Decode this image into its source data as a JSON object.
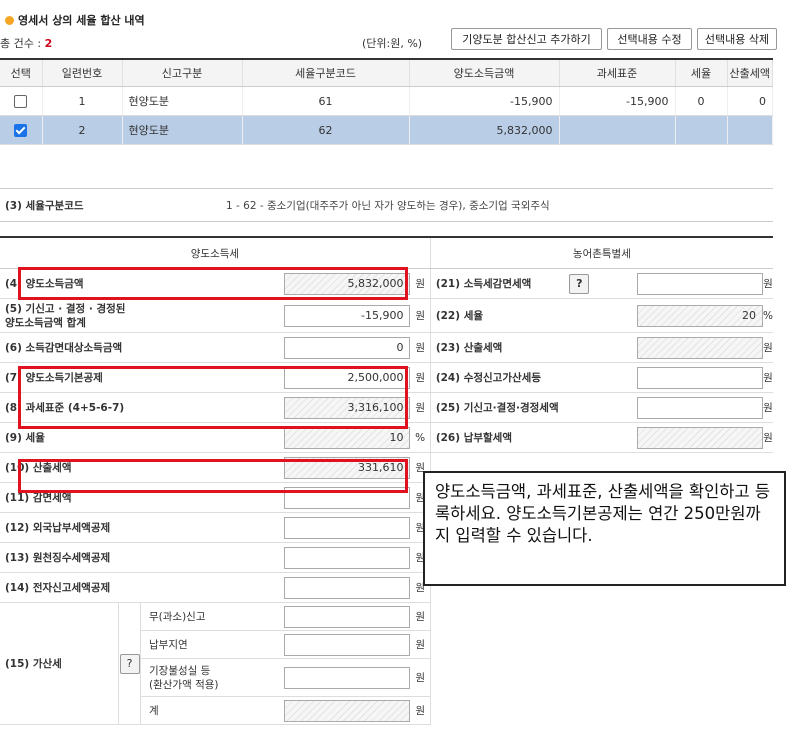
{
  "title": "영세서 상의 세율 합산 내역",
  "count_label": "총 건수 : ",
  "count_value": "2",
  "unit_label": "(단위:원, %)",
  "buttons": {
    "add": "기양도분 합산신고 추가하기",
    "edit": "선택내용 수정",
    "delete": "선택내용 삭제"
  },
  "list": {
    "headers": [
      "선택",
      "일련번호",
      "신고구분",
      "세율구분코드",
      "양도소득금액",
      "과세표준",
      "세율",
      "산출세액"
    ],
    "rows": [
      {
        "checked": false,
        "no": "1",
        "type": "현양도분",
        "code": "61",
        "amount": "-15,900",
        "base": "-15,900",
        "rate": "0",
        "tax": "0"
      },
      {
        "checked": true,
        "no": "2",
        "type": "현양도분",
        "code": "62",
        "amount": "5,832,000",
        "base": "",
        "rate": "",
        "tax": ""
      }
    ]
  },
  "code_row": {
    "label": "(3) 세율구분코드",
    "value": "1 - 62 - 중소기업(대주주가 아닌 자가 양도하는 경우), 중소기업 국외주식"
  },
  "sections": {
    "left": "양도소득세",
    "right": "농어촌특별세"
  },
  "won": "원",
  "pct": "%",
  "left_rows": [
    {
      "label": "(4) 양도소득금액",
      "value": "5,832,000",
      "unit": "원",
      "readonly": true
    },
    {
      "label": "(5) 기신고 · 결정 · 경정된\n양도소득금액 합계",
      "value": "-15,900",
      "unit": "원",
      "readonly": false
    },
    {
      "label": "(6) 소득감면대상소득금액",
      "value": "0",
      "unit": "원",
      "readonly": false
    },
    {
      "label": "(7) 양도소득기본공제",
      "value": "2,500,000",
      "unit": "원",
      "readonly": false
    },
    {
      "label": "(8) 과세표준 (4+5-6-7)",
      "value": "3,316,100",
      "unit": "원",
      "readonly": true
    },
    {
      "label": "(9) 세율",
      "value": "10",
      "unit": "%",
      "readonly": true
    },
    {
      "label": "(10) 산출세액",
      "value": "331,610",
      "unit": "원",
      "readonly": true
    },
    {
      "label": "(11) 감면세액",
      "value": "",
      "unit": "원",
      "readonly": false
    },
    {
      "label": "(12) 외국납부세액공제",
      "value": "",
      "unit": "원",
      "readonly": false
    },
    {
      "label": "(13) 원천징수세액공제",
      "value": "",
      "unit": "원",
      "readonly": false
    },
    {
      "label": "(14) 전자신고세액공제",
      "value": "",
      "unit": "원",
      "readonly": false
    }
  ],
  "right_rows": [
    {
      "label": "(21) 소득세감면세액",
      "value": "",
      "unit": "원",
      "readonly": false,
      "help": "?"
    },
    {
      "label": "(22) 세율",
      "value": "20",
      "unit": "%",
      "readonly": true
    },
    {
      "label": "(23) 산출세액",
      "value": "",
      "unit": "원",
      "readonly": true
    },
    {
      "label": "(24) 수정신고가산세등",
      "value": "",
      "unit": "원",
      "readonly": false
    },
    {
      "label": "(25) 기신고·결정·경정세액",
      "value": "",
      "unit": "원",
      "readonly": false
    },
    {
      "label": "(26) 납부할세액",
      "value": "",
      "unit": "원",
      "readonly": true
    }
  ],
  "penalty": {
    "label": "(15) 가산세",
    "help": "?",
    "items": [
      {
        "label": "무(과소)신고",
        "unit": "원"
      },
      {
        "label": "납부지연",
        "unit": "원"
      },
      {
        "label": "기장불성실 등\n(환산가액 적용)",
        "unit": "원"
      },
      {
        "label": "계",
        "unit": "원"
      }
    ]
  },
  "callout": "양도소득금액, 과세표준, 산출세액을 확인하고 등록하세요. 양도소득기본공제는 연간 250만원까지 입력할 수 있습니다."
}
